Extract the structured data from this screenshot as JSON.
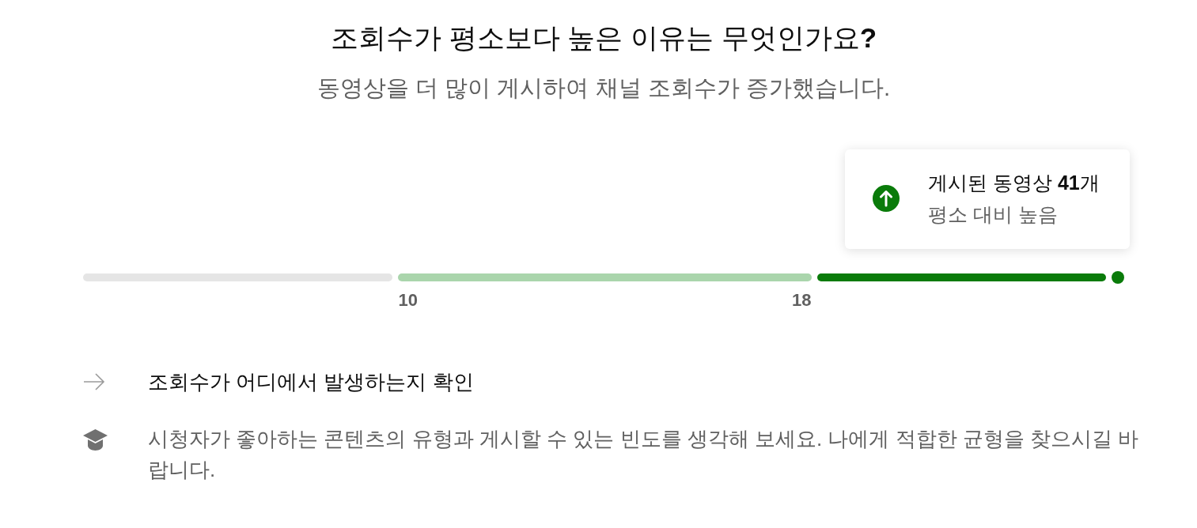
{
  "title": "조회수가 평소보다 높은 이유는 무엇인가요**?**",
  "subtitle": "동영상을 더 많이 게시하여 채널 조회수가 증가했습니다.",
  "callout": {
    "kind": "up",
    "text": "게시된 동영상 **41**개",
    "note": "평소 대비 높음"
  },
  "range": {
    "segments": [
      {
        "kind": "below"
      },
      {
        "kind": "typical"
      },
      {
        "kind": "above"
      }
    ],
    "low_label": "10",
    "high_label": "18"
  },
  "tips": [
    {
      "kind": "link",
      "text": "조회수가 어디에서 발생하는지 확인"
    },
    {
      "kind": "learn",
      "text": "시청자가 좋아하는 콘텐츠의 유형과 게시할 수 있는 빈도를 생각해 보세요. 나에게 적합한 균형을 찾으시길 바랍니다."
    }
  ]
}
